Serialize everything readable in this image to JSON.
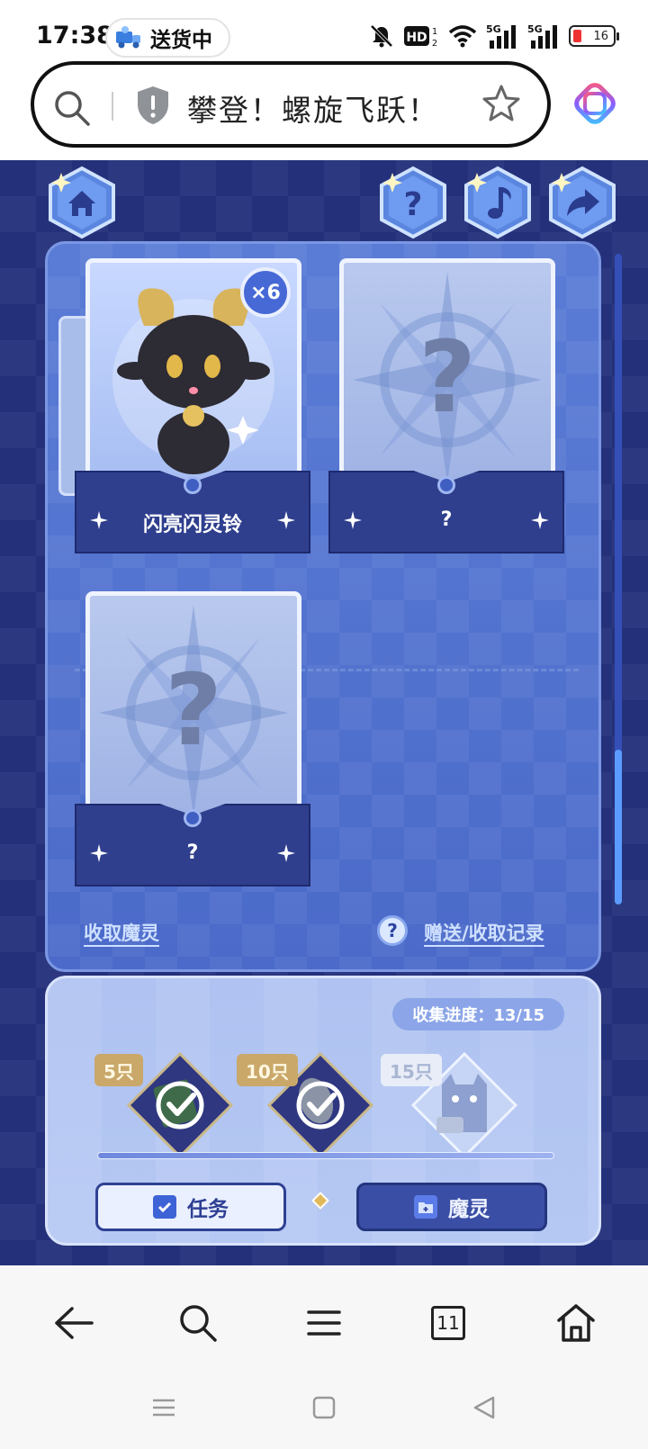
{
  "status_bar": {
    "time": "17:38",
    "delivery_label": "送货中",
    "battery": "16",
    "icons": [
      "delivery-truck-icon",
      "mute-bell-icon",
      "hd-icon",
      "wifi-icon",
      "5g-signal-icon",
      "5g-signal-icon",
      "battery-icon"
    ]
  },
  "url_bar": {
    "title": "攀登！螺旋飞跃！",
    "icons": [
      "search-icon",
      "shield-icon",
      "star-icon",
      "app-logo-icon"
    ]
  },
  "game": {
    "top_buttons": [
      "home-icon",
      "help-icon",
      "music-icon",
      "share-icon"
    ],
    "cards": [
      {
        "name": "闪亮闪灵铃",
        "count": "×6",
        "unlocked": true
      },
      {
        "name": "?",
        "unlocked": false
      },
      {
        "name": "?",
        "unlocked": false
      }
    ],
    "collect_link": "收取魔灵",
    "records_link": "赠送/收取记录",
    "help_mark": "?",
    "progress": {
      "label": "收集进度：13/15",
      "collected": 13,
      "total": 15,
      "milestones": [
        {
          "tag": "5只",
          "claimed": true
        },
        {
          "tag": "10只",
          "claimed": true
        },
        {
          "tag": "15只",
          "claimed": false
        }
      ]
    },
    "tabs": {
      "task": "任务",
      "spirit": "魔灵"
    }
  },
  "bottom_nav": {
    "tab_count": "11",
    "items": [
      "back-arrow-icon",
      "search-icon",
      "menu-icon",
      "tabs-icon",
      "home-icon"
    ]
  },
  "system_nav": [
    "recent-apps-icon",
    "home-square-icon",
    "back-triangle-icon"
  ],
  "colors": {
    "game_bg": "#24317a",
    "panel": "#5270d0",
    "progress_panel": "#b1c4f2",
    "accent_gold": "#c9a86a"
  }
}
